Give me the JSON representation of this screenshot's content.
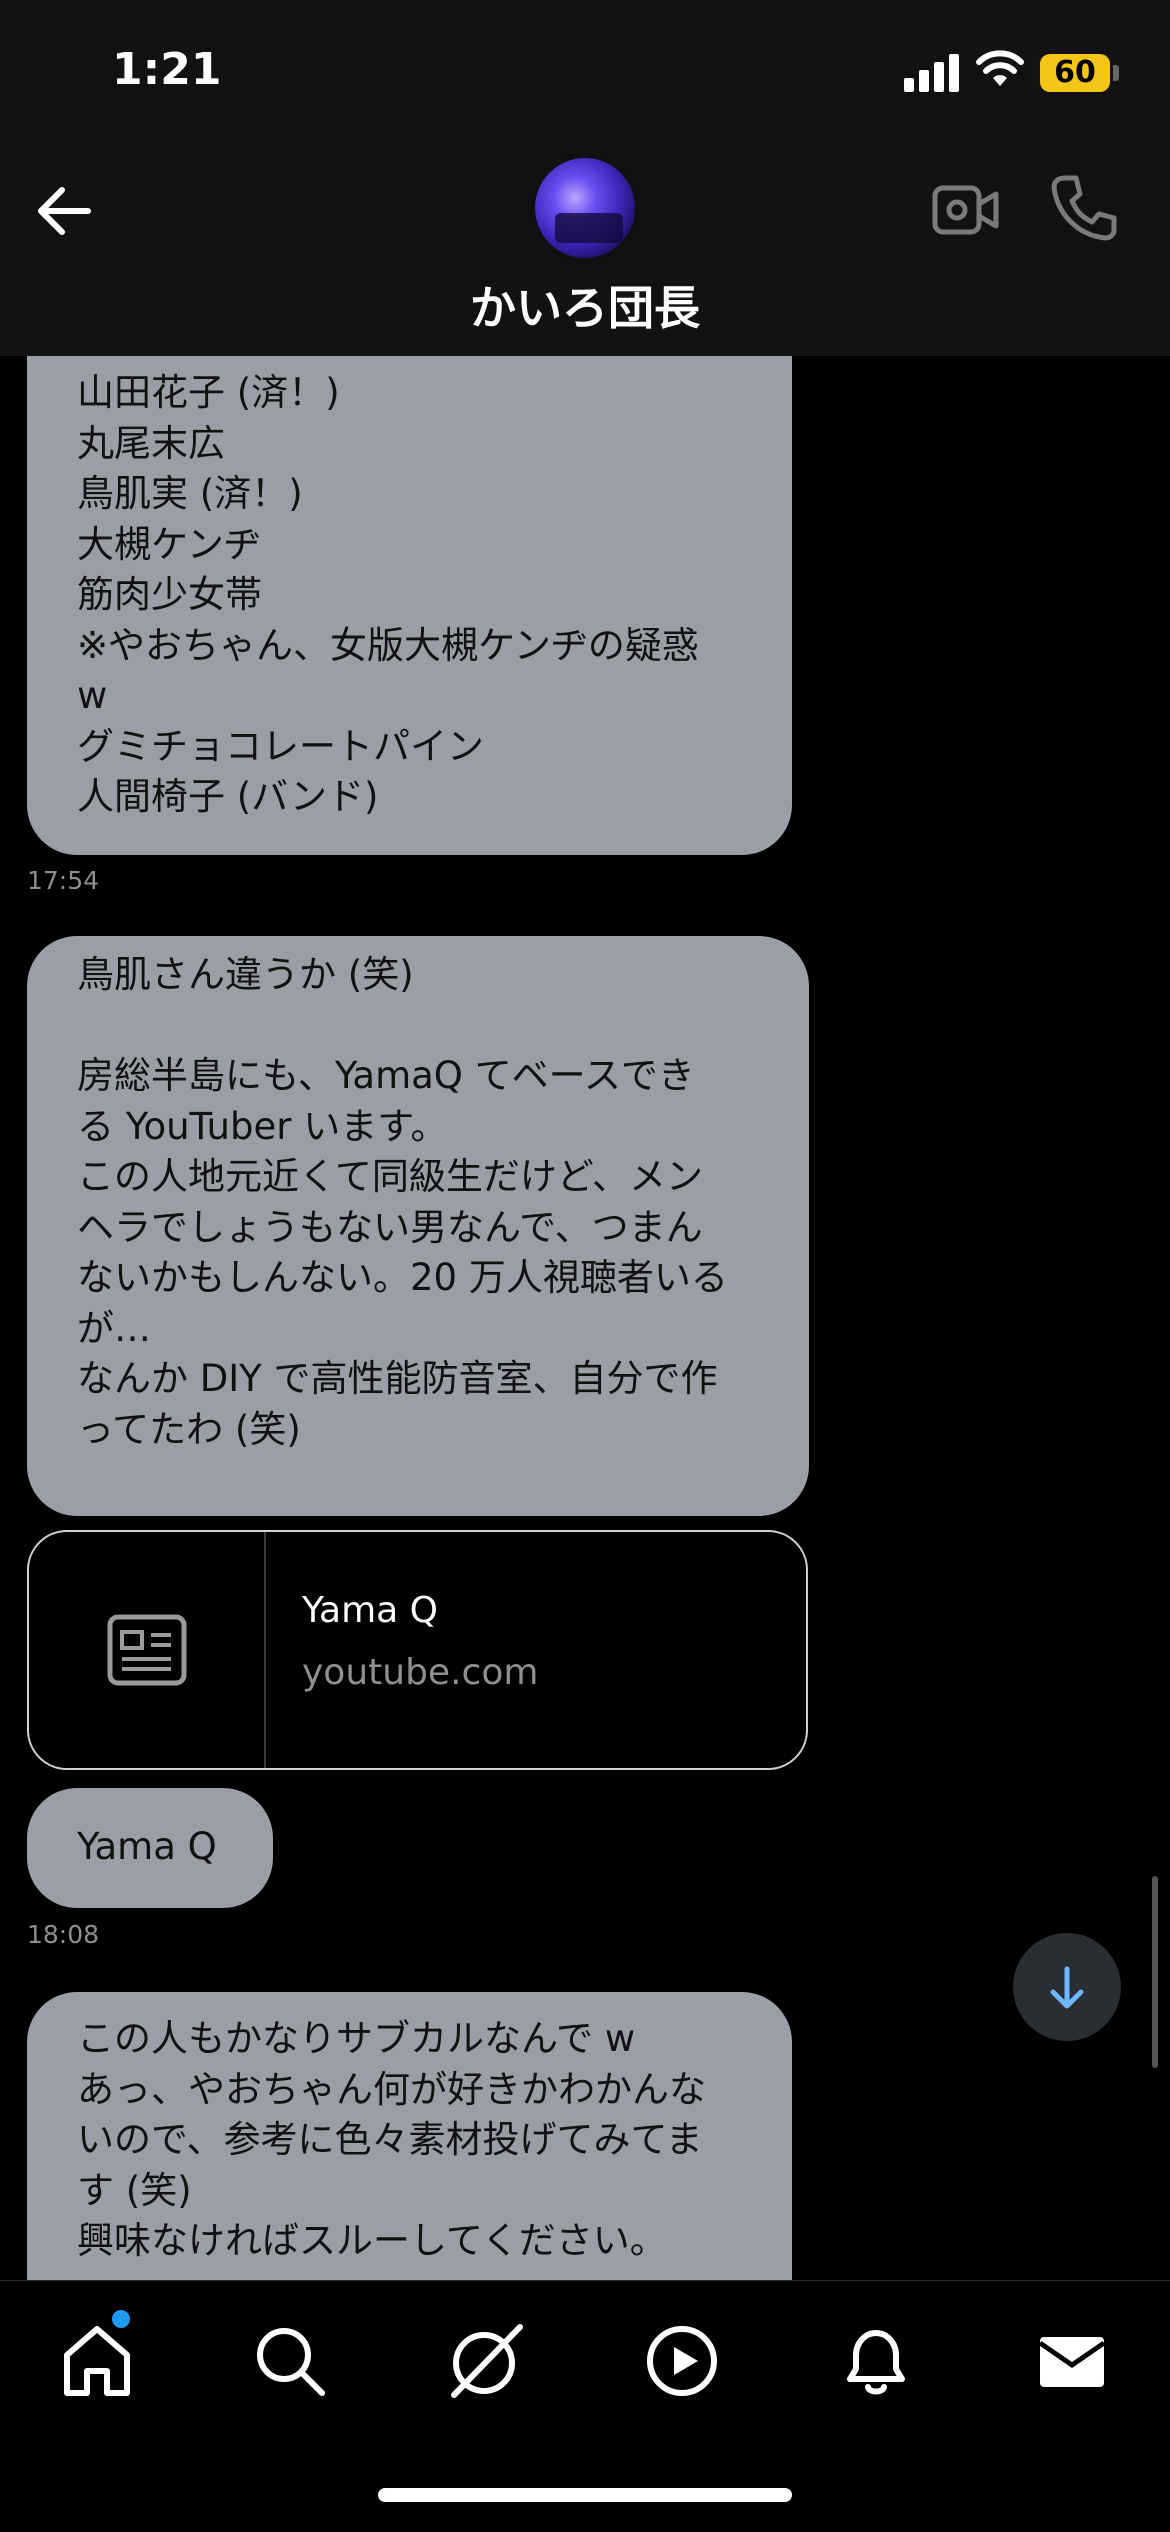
{
  "status_bar": {
    "time": "1:21",
    "battery": "60"
  },
  "header": {
    "title": "かいろ団長"
  },
  "messages": [
    {
      "text": "山田花子 (済！)\n丸尾末広\n鳥肌実 (済！)\n大槻ケンヂ\n筋肉少女帯\n※やおちゃん、女版大槻ケンヂの疑惑\nw\nグミチョコレートパイン\n人間椅子 (バンド)",
      "time": "17:54"
    },
    {
      "text": "鳥肌さん違うか (笑)\n\n房総半島にも、YamaQ てベースでき\nる YouTuber います。\nこの人地元近くて同級生だけど、メン\nヘラでしょうもない男なんで、つまん\nないかもしんない。20 万人視聴者いる\nが…\nなんか DIY で高性能防音室、自分で作\nってたわ (笑)"
    },
    {
      "link_title": "Yama Q",
      "link_domain": "youtube.com"
    },
    {
      "text": "Yama Q",
      "time": "18:08"
    },
    {
      "text": "この人もかなりサブカルなんで w\nあっ、やおちゃん何が好きかわかんな\nいので、参考に色々素材投げてみてま\nす (笑)\n興味なければスルーしてください。"
    }
  ],
  "colors": {
    "bubble": "#9a9ea6",
    "accent": "#1d9bf0",
    "battery": "#f5c518"
  },
  "icons": {
    "back": "arrow-left-icon",
    "video": "video-camera-icon",
    "call": "phone-icon",
    "link_thumb": "article-icon",
    "scroll": "arrow-down-icon",
    "tabs": [
      "home-icon",
      "search-icon",
      "grok-icon",
      "play-icon",
      "bell-icon",
      "mail-icon"
    ]
  }
}
